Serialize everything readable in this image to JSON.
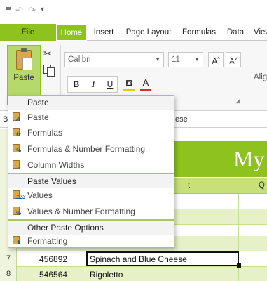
{
  "tabs": {
    "file": "File",
    "home": "Home",
    "insert": "Insert",
    "page_layout": "Page Layout",
    "formulas": "Formulas",
    "data": "Data",
    "view": "View"
  },
  "ribbon": {
    "paste_label": "Paste",
    "font_name": "Calibri",
    "font_size": "11",
    "grow_font": "A",
    "shrink_font": "A",
    "bold": "B",
    "italic": "I",
    "underline": "U",
    "font_color_letter": "A",
    "alignment_label": "Alig"
  },
  "formula_bar": {
    "name_box": "B",
    "content": "ese"
  },
  "sheet": {
    "title_text": "My",
    "header_t": "t",
    "header_q": "Q",
    "rows": [
      {
        "num": "7",
        "id": "456892",
        "name": "Spinach and Blue Cheese"
      },
      {
        "num": "8",
        "id": "546564",
        "name": "Rigoletto"
      }
    ]
  },
  "paste_menu": {
    "section_paste": "Paste",
    "items_paste": [
      {
        "label": "Paste",
        "icon": "paste-icon"
      },
      {
        "label": "Formulas",
        "icon": "paste-formulas-icon"
      },
      {
        "label": "Formulas & Number Formatting",
        "icon": "paste-formulas-number-icon"
      },
      {
        "label": "Column Widths",
        "icon": "column-widths-icon"
      }
    ],
    "section_values": "Paste Values",
    "items_values": [
      {
        "label": "Values",
        "icon": "paste-values-icon"
      },
      {
        "label": "Values & Number Formatting",
        "icon": "values-number-formatting-icon"
      }
    ],
    "section_other": "Other Paste Options",
    "items_other": [
      {
        "label": "Formatting",
        "icon": "formatting-icon"
      }
    ]
  },
  "colors": {
    "accent": "#8dc21f",
    "header_fill": "#c8e07a",
    "alt_row": "#e6f1c7"
  }
}
